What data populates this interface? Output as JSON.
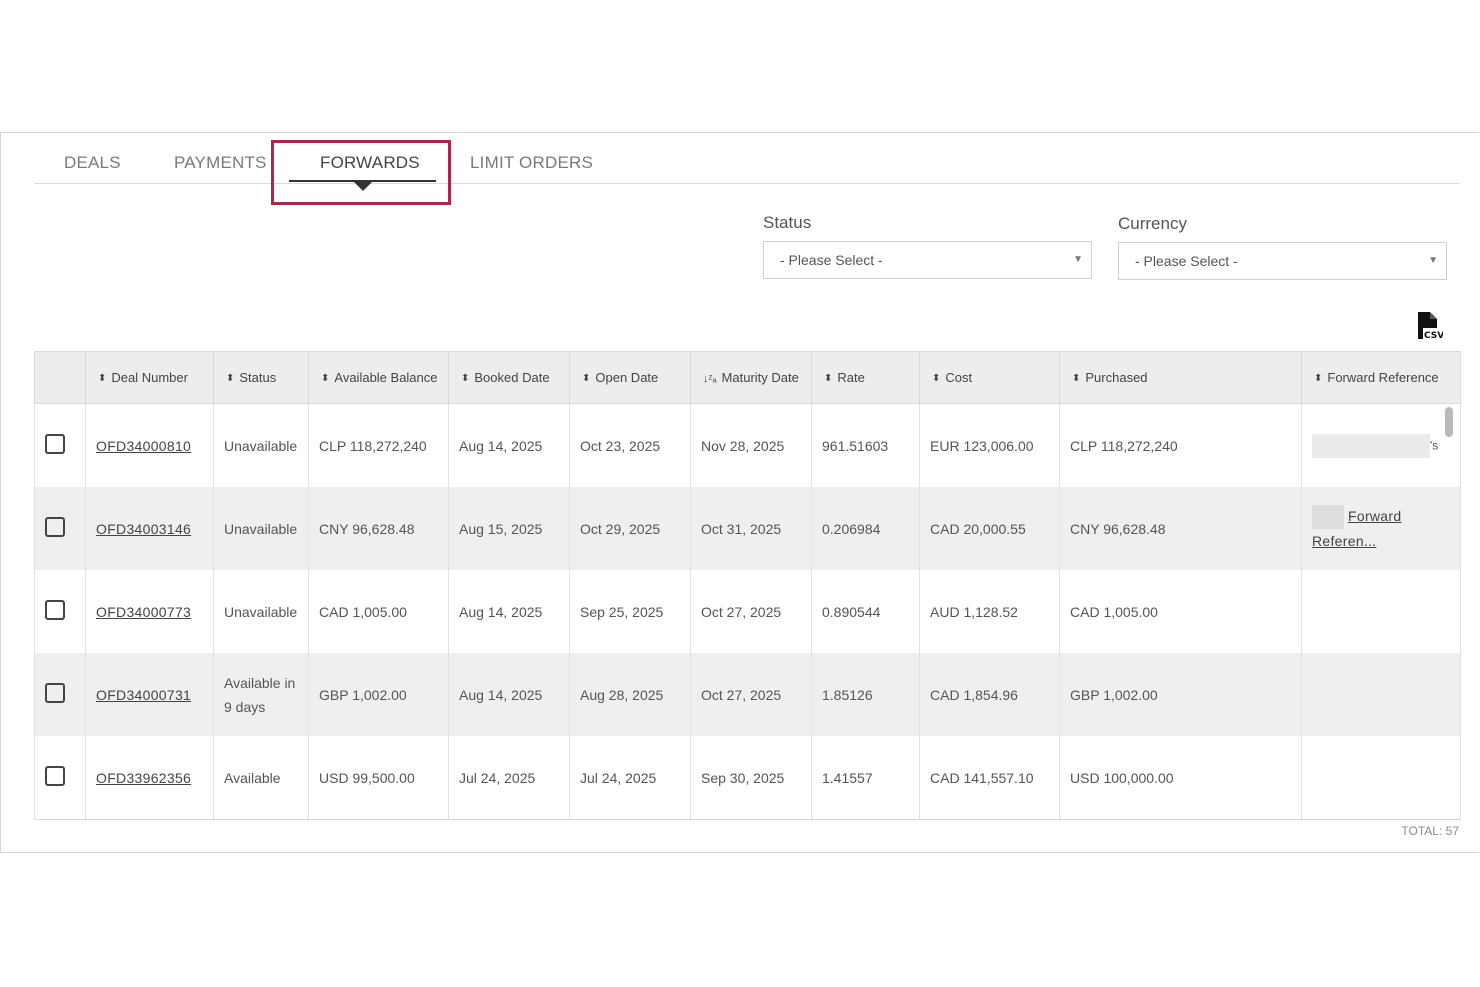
{
  "tabs": [
    {
      "label": "DEALS"
    },
    {
      "label": "PAYMENTS"
    },
    {
      "label": "FORWARDS"
    },
    {
      "label": "LIMIT ORDERS"
    }
  ],
  "active_tab": "FORWARDS",
  "filters": {
    "status": {
      "label": "Status",
      "value": "- Please Select -"
    },
    "currency": {
      "label": "Currency",
      "value": "- Please Select -"
    }
  },
  "export": {
    "icon": "csv-file-icon",
    "label": "CSV"
  },
  "table": {
    "columns": [
      {
        "label": "Deal Number",
        "sort": "unsorted"
      },
      {
        "label": "Status",
        "sort": "unsorted"
      },
      {
        "label": "Available Balance",
        "sort": "unsorted"
      },
      {
        "label": "Booked Date",
        "sort": "unsorted"
      },
      {
        "label": "Open Date",
        "sort": "unsorted"
      },
      {
        "label": "Maturity Date",
        "sort": "descending"
      },
      {
        "label": "Rate",
        "sort": "unsorted"
      },
      {
        "label": "Cost",
        "sort": "unsorted"
      },
      {
        "label": "Purchased",
        "sort": "unsorted"
      },
      {
        "label": "Forward Reference",
        "sort": "unsorted"
      }
    ],
    "rows": [
      {
        "deal": "OFD34000810",
        "status": "Unavailable",
        "balance": "CLP 118,272,240",
        "booked": "Aug 14, 2025",
        "open": "Oct 23, 2025",
        "maturity": "Nov 28, 2025",
        "rate": "961.51603",
        "cost": "EUR 123,006.00",
        "purchased": "CLP 118,272,240",
        "ref_tail": "'s"
      },
      {
        "deal": "OFD34003146",
        "status": "Unavailable",
        "balance": "CNY 96,628.48",
        "booked": "Aug 15, 2025",
        "open": "Oct 29, 2025",
        "maturity": "Oct 31, 2025",
        "rate": "0.206984",
        "cost": "CAD 20,000.55",
        "purchased": "CNY 96,628.48",
        "ref_line1": "Forward",
        "ref_line2": "Referen..."
      },
      {
        "deal": "OFD34000773",
        "status": "Unavailable",
        "balance": "CAD 1,005.00",
        "booked": "Aug 14, 2025",
        "open": "Sep 25, 2025",
        "maturity": "Oct 27, 2025",
        "rate": "0.890544",
        "cost": "AUD 1,128.52",
        "purchased": "CAD 1,005.00"
      },
      {
        "deal": "OFD34000731",
        "status_line1": "Available in",
        "status_line2": "9 days",
        "balance": "GBP 1,002.00",
        "booked": "Aug 14, 2025",
        "open": "Aug 28, 2025",
        "maturity": "Oct 27, 2025",
        "rate": "1.85126",
        "cost": "CAD 1,854.96",
        "purchased": "GBP 1,002.00"
      },
      {
        "deal": "OFD33962356",
        "status": "Available",
        "balance": "USD 99,500.00",
        "booked": "Jul 24, 2025",
        "open": "Jul 24, 2025",
        "maturity": "Sep 30, 2025",
        "rate": "1.41557",
        "cost": "CAD 141,557.10",
        "purchased": "USD 100,000.00"
      }
    ],
    "total": "TOTAL: 57"
  },
  "colors": {
    "highlight": "#b0254a",
    "header_bg": "#ededed",
    "alt_row": "#efefef"
  }
}
